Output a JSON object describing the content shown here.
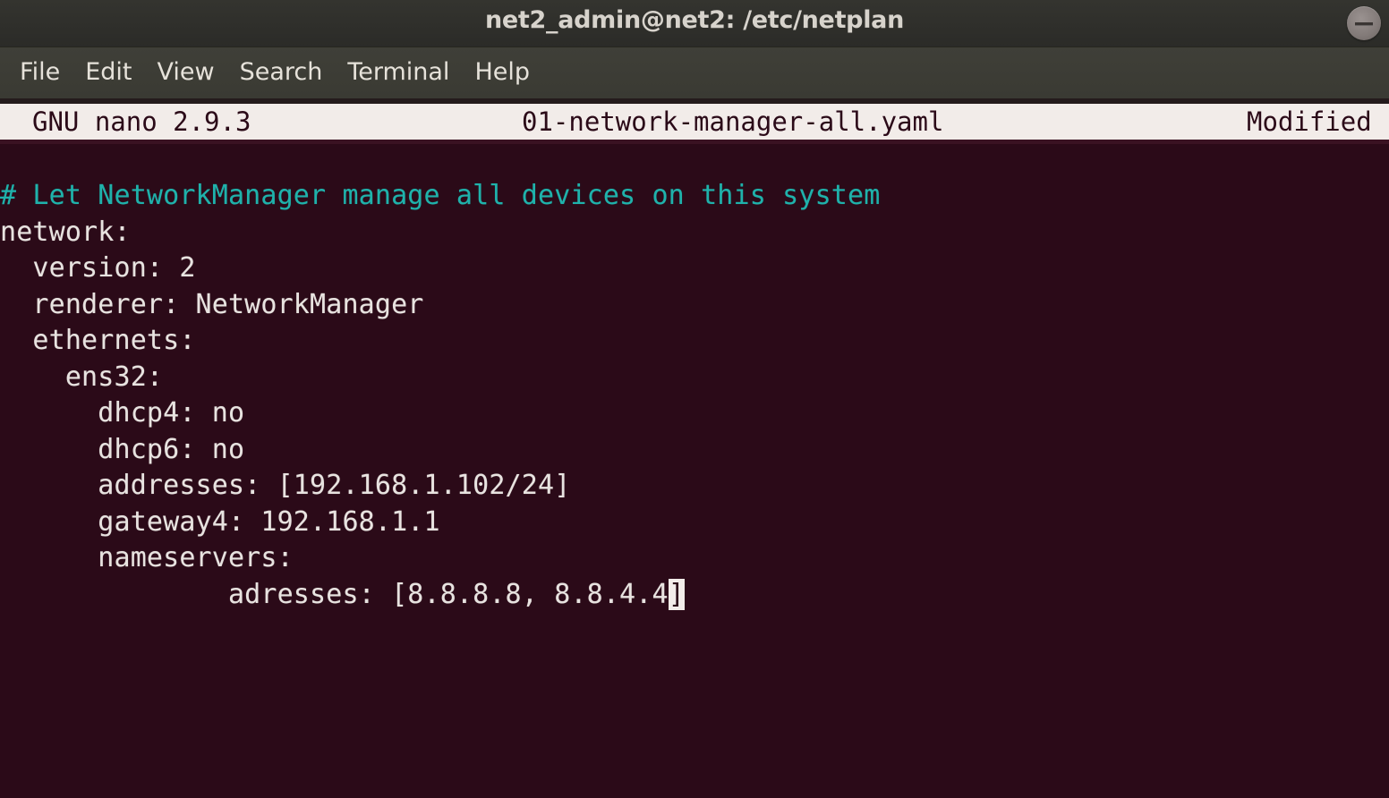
{
  "window": {
    "title": "net2_admin@net2: /etc/netplan",
    "minimize_icon": "minimize-icon"
  },
  "menubar": {
    "items": [
      {
        "label": "File"
      },
      {
        "label": "Edit"
      },
      {
        "label": "View"
      },
      {
        "label": "Search"
      },
      {
        "label": "Terminal"
      },
      {
        "label": "Help"
      }
    ]
  },
  "nano": {
    "version": "GNU nano 2.9.3",
    "filename": "01-network-manager-all.yaml",
    "status": "Modified"
  },
  "editor": {
    "lines": [
      {
        "text": "# Let NetworkManager manage all devices on this system",
        "type": "comment"
      },
      {
        "text": "network:",
        "type": "text"
      },
      {
        "text": "  version: 2",
        "type": "text"
      },
      {
        "text": "  renderer: NetworkManager",
        "type": "text"
      },
      {
        "text": "  ethernets:",
        "type": "text"
      },
      {
        "text": "    ens32:",
        "type": "text"
      },
      {
        "text": "      dhcp4: no",
        "type": "text"
      },
      {
        "text": "      dhcp6: no",
        "type": "text"
      },
      {
        "text": "      addresses: [192.168.1.102/24]",
        "type": "text"
      },
      {
        "text": "      gateway4: 192.168.1.1",
        "type": "text"
      },
      {
        "text": "      nameservers:",
        "type": "text"
      },
      {
        "text": "              adresses: [8.8.8.8, 8.8.4.4",
        "type": "text",
        "cursor_char": "]"
      }
    ]
  },
  "colors": {
    "terminal_background": "#2b0a18",
    "terminal_foreground": "#e8e3e0",
    "comment": "#1fb2ab",
    "titlebar": "#2f2f2b",
    "menubar": "#3c3c35",
    "nano_header_background": "#f2ece9",
    "nano_header_foreground": "#2b0a18",
    "cursor": "#f2ece9"
  }
}
